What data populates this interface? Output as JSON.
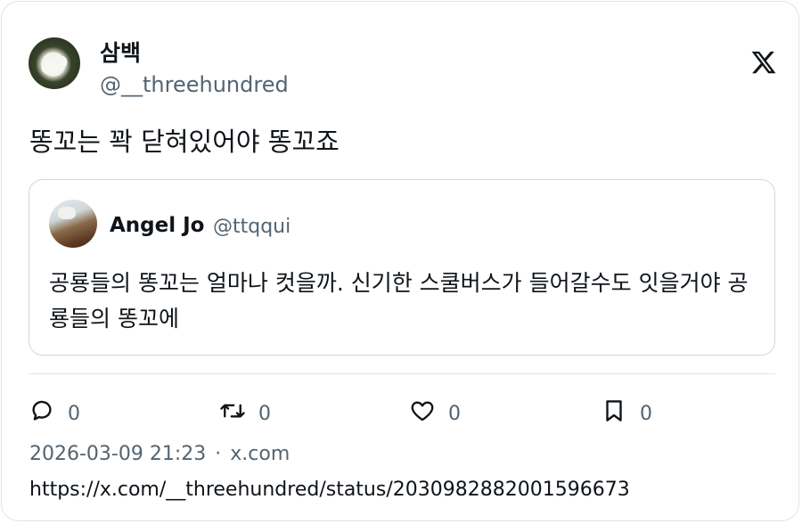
{
  "author": {
    "display_name": "삼백",
    "handle": "@__threehundred"
  },
  "tweet": {
    "text": "똥꼬는 꽉 닫혀있어야 똥꼬죠"
  },
  "quoted": {
    "display_name": "Angel Jo",
    "handle": "@ttqqui",
    "text": "공룡들의 똥꼬는 얼마나 컷을까. 신기한 스쿨버스가 들어갈수도 잇을거야 공룡들의 똥꼬에"
  },
  "actions": {
    "reply": {
      "icon": "reply-icon",
      "count": "0"
    },
    "retweet": {
      "icon": "retweet-icon",
      "count": "0"
    },
    "like": {
      "icon": "heart-icon",
      "count": "0"
    },
    "bookmark": {
      "icon": "bookmark-icon",
      "count": "0"
    }
  },
  "meta": {
    "timestamp": "2026-03-09 21:23",
    "separator": "·",
    "source": "x.com"
  },
  "url": "https://x.com/__threehundred/status/2030982882001596673",
  "colors": {
    "text_primary": "#0f1419",
    "text_secondary": "#536471",
    "border": "#cfd9de"
  }
}
